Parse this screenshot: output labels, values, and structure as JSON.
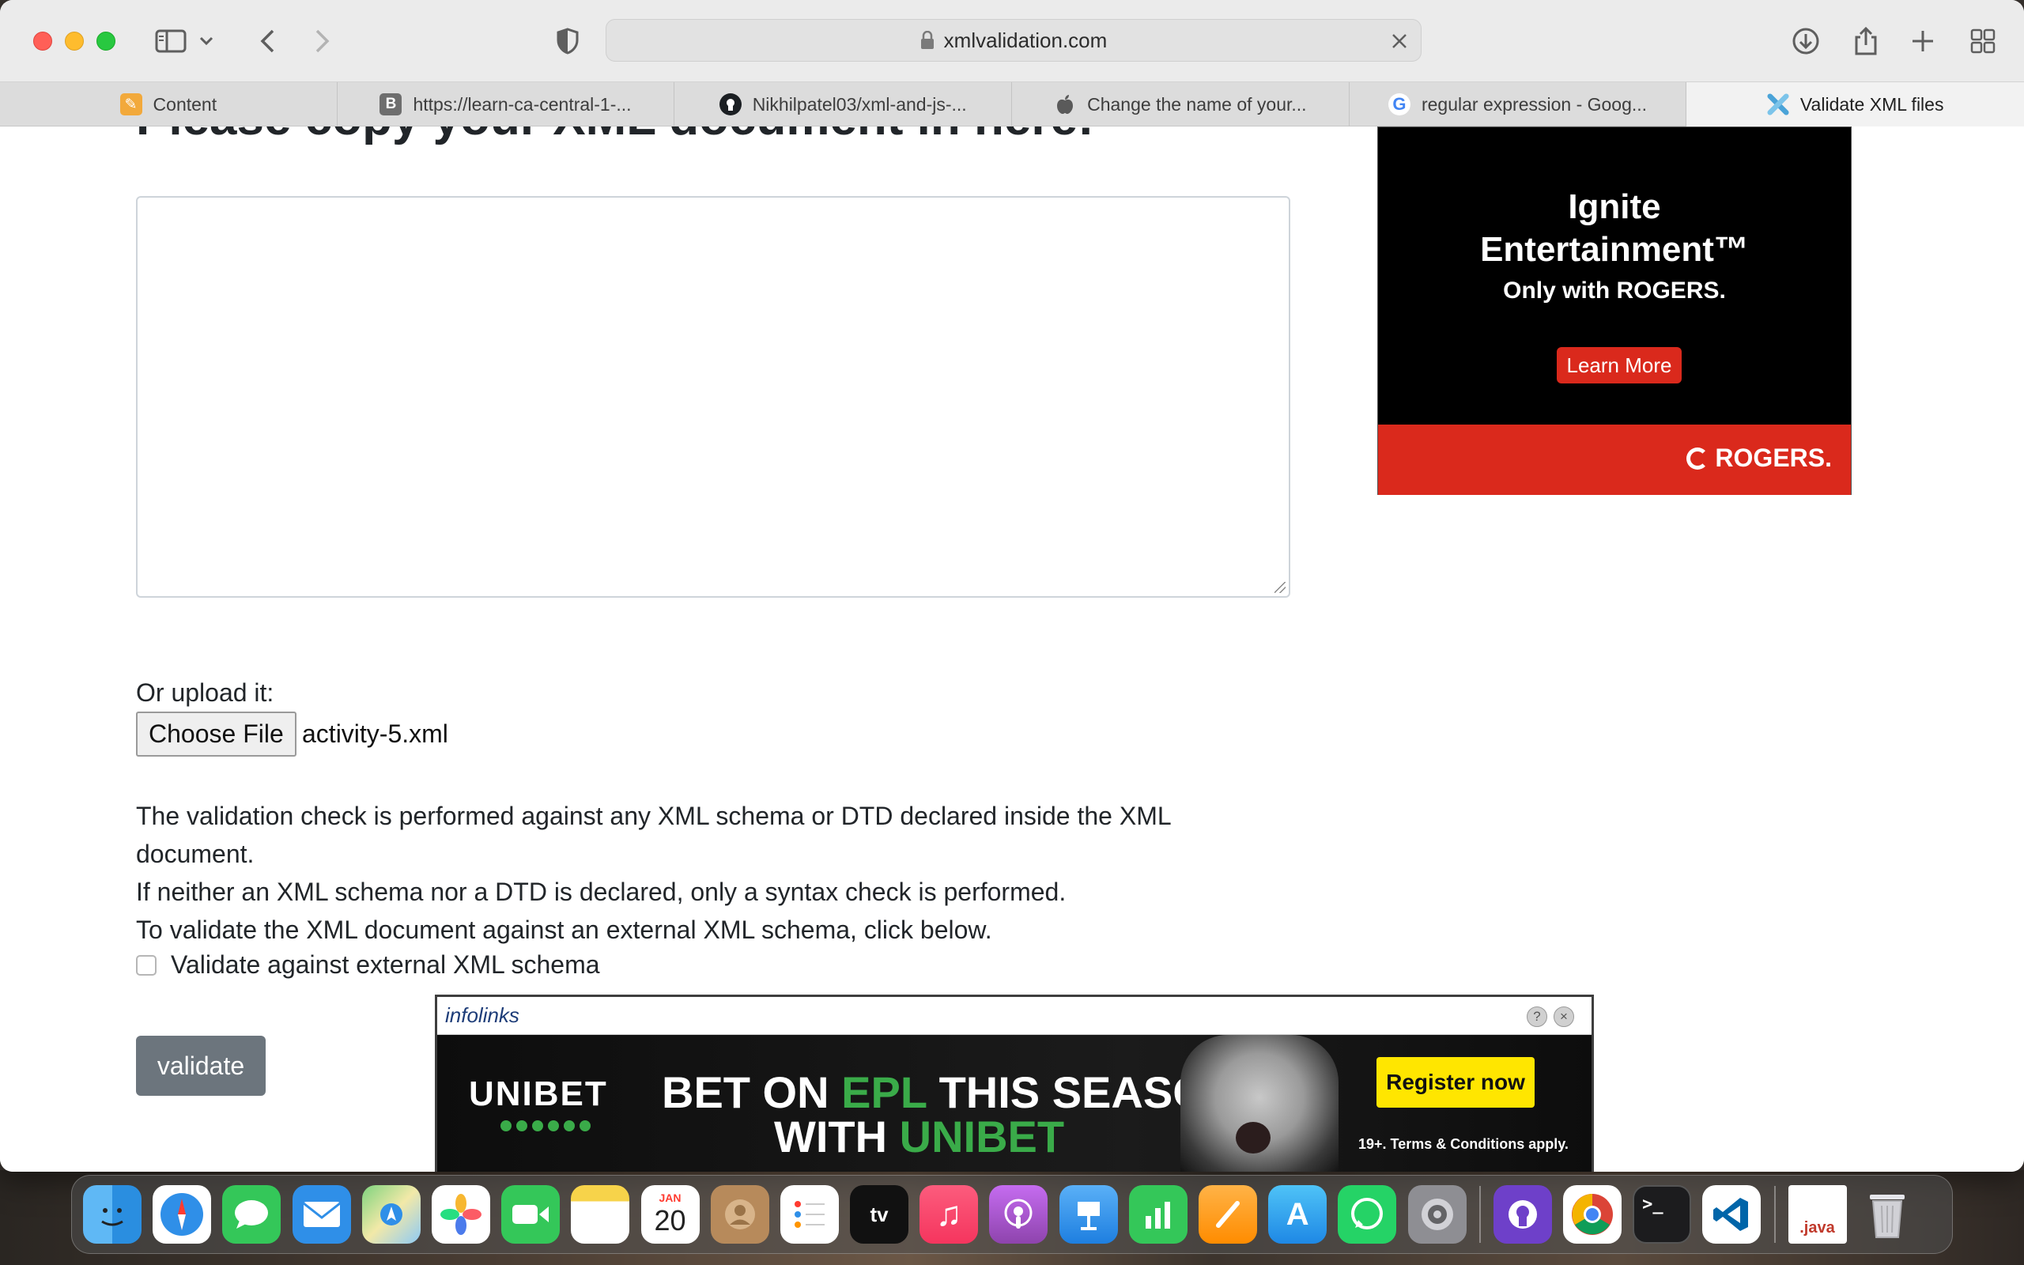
{
  "browser": {
    "url": "xmlvalidation.com",
    "tabs": [
      {
        "label": "Content",
        "icon": "pencil-icon"
      },
      {
        "label": "https://learn-ca-central-1-...",
        "icon": "b-icon"
      },
      {
        "label": "Nikhilpatel03/xml-and-js-...",
        "icon": "github-icon"
      },
      {
        "label": "Change the name of your...",
        "icon": "apple-icon"
      },
      {
        "label": "regular expression - Goog...",
        "icon": "google-icon"
      },
      {
        "label": "Validate XML files",
        "icon": "x-logo-icon",
        "active": true
      }
    ]
  },
  "page": {
    "heading": "Please copy your XML document in here:",
    "upload_label": "Or upload it:",
    "choose_file_label": "Choose File",
    "file_name": "activity-5.xml",
    "description": [
      "The validation check is performed against any XML schema or DTD declared inside the XML document.",
      "If neither an XML schema nor a DTD is declared, only a syntax check is performed.",
      "To validate the XML document against an external XML schema, click below."
    ],
    "schema_checkbox_label": "Validate against external XML schema",
    "schema_checked": false,
    "validate_label": "validate"
  },
  "ads": {
    "rogers": {
      "headline_1": "Ignite",
      "headline_2": "Entertainment™",
      "tagline": "Only with ROGERS.",
      "cta": "Learn More",
      "brand": "ROGERS."
    },
    "infolinks": {
      "brand": "infolinks",
      "help": "?",
      "close": "×",
      "advertiser": "UNIBET",
      "line1_a": "BET ON ",
      "line1_b": "EPL",
      "line1_c": " THIS SEASON",
      "line2_a": "WITH ",
      "line2_b": "UNIBET",
      "cta": "Register now",
      "terms": "19+. Terms & Conditions apply."
    }
  },
  "dock": {
    "calendar_month": "JAN",
    "calendar_day": "20",
    "java_label": ".java",
    "apps": [
      "finder",
      "safari",
      "messages",
      "mail",
      "maps",
      "photos",
      "facetime",
      "notes",
      "calendar",
      "contacts",
      "reminders",
      "tv",
      "music",
      "podcasts",
      "keynote",
      "numbers",
      "pages",
      "app-store",
      "whatsapp",
      "system-preferences",
      "github-desktop",
      "chrome",
      "terminal",
      "vscode",
      "java-file",
      "trash"
    ]
  },
  "colors": {
    "validate_button": "#6c757d",
    "rogers_red": "#da291c",
    "unibet_green": "#3aab49",
    "register_yellow": "#ffe600"
  }
}
